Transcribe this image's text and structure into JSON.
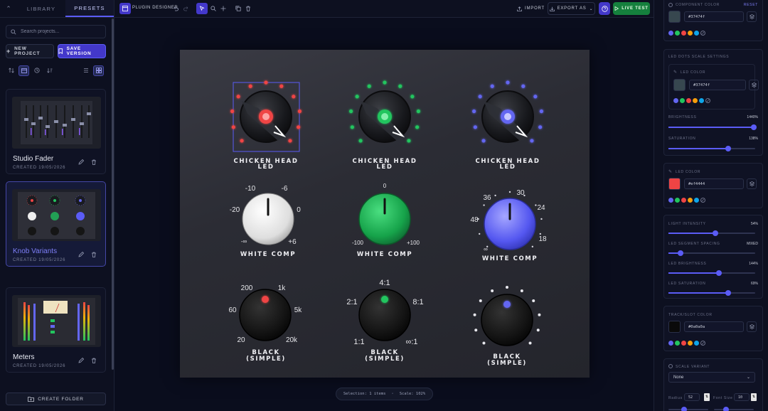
{
  "sidebar": {
    "tabs": [
      "LIBRARY",
      "PRESETS"
    ],
    "search_placeholder": "Search projects...",
    "new_project": "NEW PROJECT",
    "save_version": "SAVE VERSION",
    "presets": [
      {
        "name": "Studio Fader",
        "date": "CREATED 19/05/2026"
      },
      {
        "name": "Knob Variants",
        "date": "CREATED 19/05/2026"
      },
      {
        "name": "Meters",
        "date": "CREATED 19/05/2026"
      }
    ],
    "create_folder": "CREATE FOLDER"
  },
  "topbar": {
    "title": "PLUGIN DESIGNER",
    "import": "IMPORT",
    "export": "EXPORT AS",
    "live": "LIVE TEST"
  },
  "canvas": {
    "knobs": [
      {
        "label": [
          "CHICKEN HEAD",
          "LED"
        ],
        "color": "#ef4444"
      },
      {
        "label": [
          "CHICKEN HEAD",
          "LED"
        ],
        "color": "#22c55e"
      },
      {
        "label": [
          "CHICKEN HEAD",
          "LED"
        ],
        "color": "#6366f1"
      },
      {
        "label": [
          "WHITE COMP"
        ],
        "scale": [
          "-10",
          "-6",
          "-20",
          "0",
          "-∞",
          "+6"
        ]
      },
      {
        "label": [
          "WHITE COMP"
        ],
        "scale": [
          "0",
          "-100",
          "+100"
        ]
      },
      {
        "label": [
          "WHITE COMP"
        ],
        "scale": [
          "36",
          "30",
          "48",
          "24",
          "18",
          "∞"
        ]
      },
      {
        "label": [
          "BLACK",
          "(SIMPLE)"
        ],
        "scale": [
          "200",
          "1k",
          "60",
          "5k",
          "20",
          "20k"
        ]
      },
      {
        "label": [
          "BLACK",
          "(SIMPLE)"
        ],
        "scale": [
          "4:1",
          "2:1",
          "8:1",
          "1:1",
          "∞:1"
        ]
      },
      {
        "label": [
          "BLACK",
          "(SIMPLE)"
        ]
      }
    ],
    "status": {
      "selection": "Selection: 1 items",
      "scale": "Scale: 102%"
    }
  },
  "panel": {
    "component_color": {
      "label": "COMPONENT COLOR",
      "reset": "RESET",
      "value": "#37474f"
    },
    "led_dots": {
      "title": "LED DOTS SCALE SETTINGS",
      "led_color_label": "LED COLOR",
      "led_color_value": "#37474f",
      "brightness_label": "BRIGHTNESS",
      "brightness_value": "1440%",
      "brightness_level": 0.98,
      "saturation_label": "SATURATION",
      "saturation_value": "138%",
      "saturation_level": 0.69
    },
    "led_color": {
      "label": "LED COLOR",
      "value": "#ef4444"
    },
    "sliders": [
      {
        "label": "LIGHT INTENSITY",
        "value": "54%",
        "level": 0.54
      },
      {
        "label": "LED SEGMENT SPACING",
        "value": "MIXED",
        "level": 0.14
      },
      {
        "label": "LED BRIGHTNESS",
        "value": "144%",
        "level": 0.58
      },
      {
        "label": "LED SATURATION",
        "value": "69%",
        "level": 0.69
      }
    ],
    "track_color": {
      "label": "TRACK/SLOT COLOR",
      "value": "#0a0a0a"
    },
    "scale_variant": {
      "label": "SCALE VARIANT",
      "selected": "None"
    },
    "radius": {
      "label": "Radius",
      "value": "52"
    },
    "font_size": {
      "label": "Font Size",
      "value": "10"
    },
    "palette": [
      "#6366f1",
      "#22c55e",
      "#ef4444",
      "#f59e0b",
      "#0ea5e9"
    ]
  }
}
